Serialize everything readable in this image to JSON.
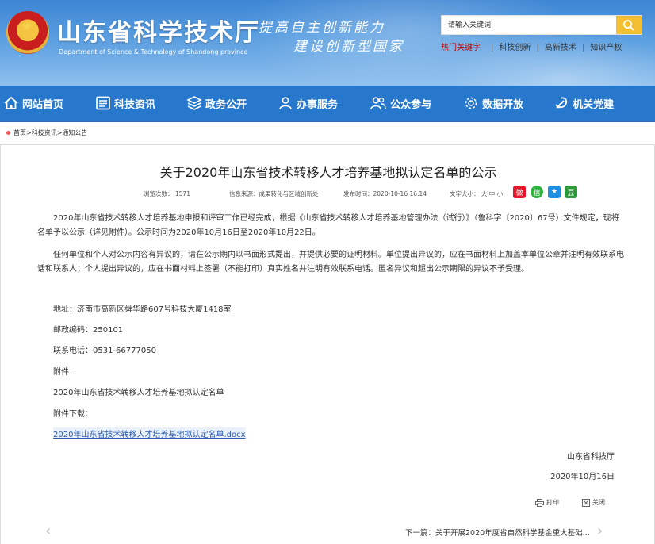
{
  "header": {
    "site_title": "山东省科学技术厅",
    "site_subtitle": "Department of Science & Technology of Shandong province",
    "slogan_line1": "提高自主创新能力",
    "slogan_line2": "建设创新型国家",
    "search": {
      "placeholder": "请输入关键词"
    },
    "hot_label": "热门关键字",
    "hot_keywords": [
      "科技创新",
      "高新技术",
      "知识产权"
    ]
  },
  "nav": {
    "items": [
      {
        "label": "网站首页",
        "icon": "home-icon"
      },
      {
        "label": "科技资讯",
        "icon": "news-icon"
      },
      {
        "label": "政务公开",
        "icon": "layers-icon"
      },
      {
        "label": "办事服务",
        "icon": "service-icon"
      },
      {
        "label": "公众参与",
        "icon": "people-icon"
      },
      {
        "label": "数据开放",
        "icon": "gear-icon"
      },
      {
        "label": "机关党建",
        "icon": "party-icon"
      }
    ]
  },
  "breadcrumb": {
    "items": [
      "首页",
      "科技资讯",
      "通知公告"
    ],
    "separator": ">"
  },
  "article": {
    "title": "关于2020年山东省技术转移人才培养基地拟认定名单的公示",
    "views": "浏览次数： 1571",
    "source": "信息来源：成果转化与区域创新处",
    "publish_time": "发布时间：2020-10-16 16:14",
    "font_size_label": "文字大小：",
    "font_sizes": [
      "大",
      "中",
      "小"
    ],
    "para1": "2020年山东省技术转移人才培养基地申报和评审工作已经完成，根据《山东省技术转移人才培养基地管理办法（试行）》（鲁科字〔2020〕67号）文件规定，现将名单予以公示（详见附件）。公示时间为2020年10月16日至2020年10月22日。",
    "para2": "任何单位和个人对公示内容有异议的，请在公示期内以书面形式提出，并提供必要的证明材料。单位提出异议的，应在书面材料上加盖本单位公章并注明有效联系电话和联系人；个人提出异议的，应在书面材料上签署（不能打印）真实姓名并注明有效联系电话。匿名异议和超出公示期限的异议不予受理。",
    "address": "地址：济南市高新区舜华路607号科技大厦1418室",
    "postcode": "邮政编码：250101",
    "phone": "联系电话：0531-66777050",
    "attachment_label": "附件：",
    "attachment_name": "2020年山东省技术转移人才培养基地拟认定名单",
    "download_label": "附件下载：",
    "download_file": "2020年山东省技术转移人才培养基地拟认定名单.docx",
    "signature": "山东省科技厅",
    "date": "2020年10月16日",
    "print_label": "打印",
    "close_label": "关闭",
    "next_label": "下一篇：关于开展2020年度省自然科学基金重大基础..."
  },
  "colors": {
    "nav_bg": "#2778cc",
    "search_button": "#f3c034",
    "hot_label": "#c40000",
    "link": "#2b5db1"
  }
}
